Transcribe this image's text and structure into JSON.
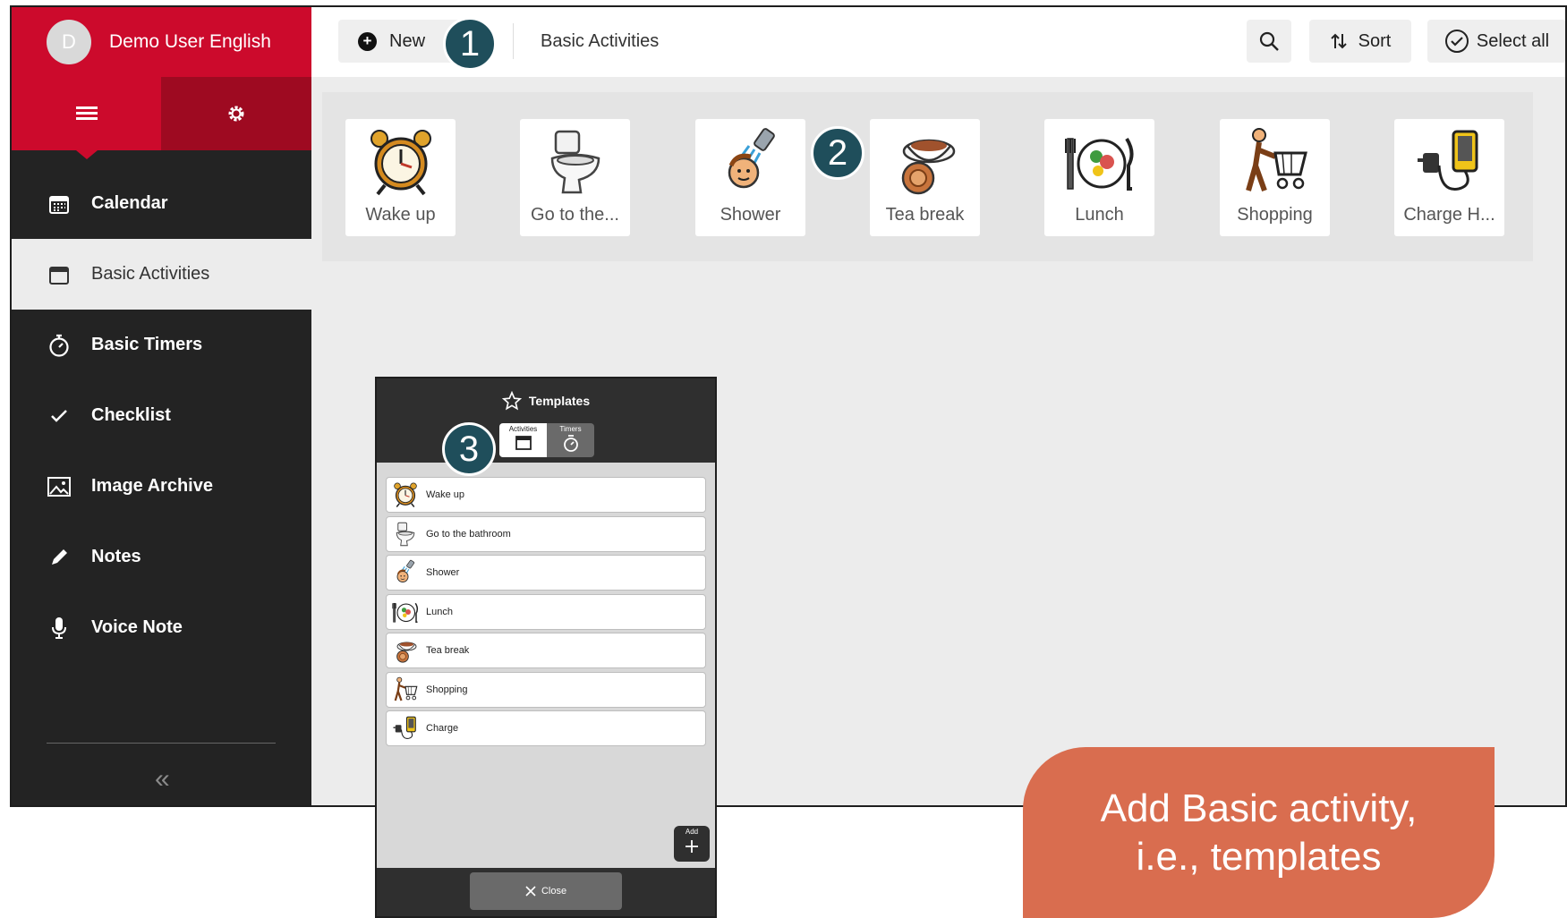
{
  "sidebar": {
    "user": {
      "initial": "D",
      "name": "Demo User English"
    },
    "items": [
      {
        "label": "Calendar",
        "icon": "calendar-grid-icon"
      },
      {
        "label": "Basic Activities",
        "icon": "calendar-icon",
        "active": true
      },
      {
        "label": "Basic Timers",
        "icon": "timer-icon"
      },
      {
        "label": "Checklist",
        "icon": "check-icon"
      },
      {
        "label": "Image Archive",
        "icon": "image-icon"
      },
      {
        "label": "Notes",
        "icon": "pencil-icon"
      },
      {
        "label": "Voice Note",
        "icon": "microphone-icon"
      }
    ],
    "collapse_glyph": "«"
  },
  "topbar": {
    "new_label": "New",
    "breadcrumb": "Basic Activities",
    "sort_label": "Sort",
    "select_all_label": "Select all"
  },
  "activities": [
    {
      "label": "Wake up",
      "icon": "alarm-clock-icon"
    },
    {
      "label": "Go to the...",
      "icon": "toilet-icon"
    },
    {
      "label": "Shower",
      "icon": "shower-icon"
    },
    {
      "label": "Tea break",
      "icon": "tea-cup-icon"
    },
    {
      "label": "Lunch",
      "icon": "plate-icon"
    },
    {
      "label": "Shopping",
      "icon": "shopping-cart-icon"
    },
    {
      "label": "Charge H...",
      "icon": "charger-icon"
    }
  ],
  "templates": {
    "title": "Templates",
    "tabs": [
      {
        "label": "Activities",
        "active": true
      },
      {
        "label": "Timers",
        "active": false
      }
    ],
    "items": [
      {
        "label": "Wake up",
        "icon": "alarm-clock-icon"
      },
      {
        "label": "Go to the bathroom",
        "icon": "toilet-icon"
      },
      {
        "label": "Shower",
        "icon": "shower-icon"
      },
      {
        "label": "Lunch",
        "icon": "plate-icon"
      },
      {
        "label": "Tea break",
        "icon": "tea-cup-icon"
      },
      {
        "label": "Shopping",
        "icon": "shopping-cart-icon"
      },
      {
        "label": "Charge",
        "icon": "charger-icon"
      }
    ],
    "add_label": "Add",
    "close_label": "Close"
  },
  "badges": [
    "1",
    "2",
    "3"
  ],
  "callout": {
    "line1": "Add Basic activity,",
    "line2": "i.e., templates"
  },
  "colors": {
    "brand_red": "#cc0a2c",
    "sidebar_dark": "#232323",
    "badge_teal": "#1f4e5b",
    "callout_orange": "#d96d4f"
  }
}
